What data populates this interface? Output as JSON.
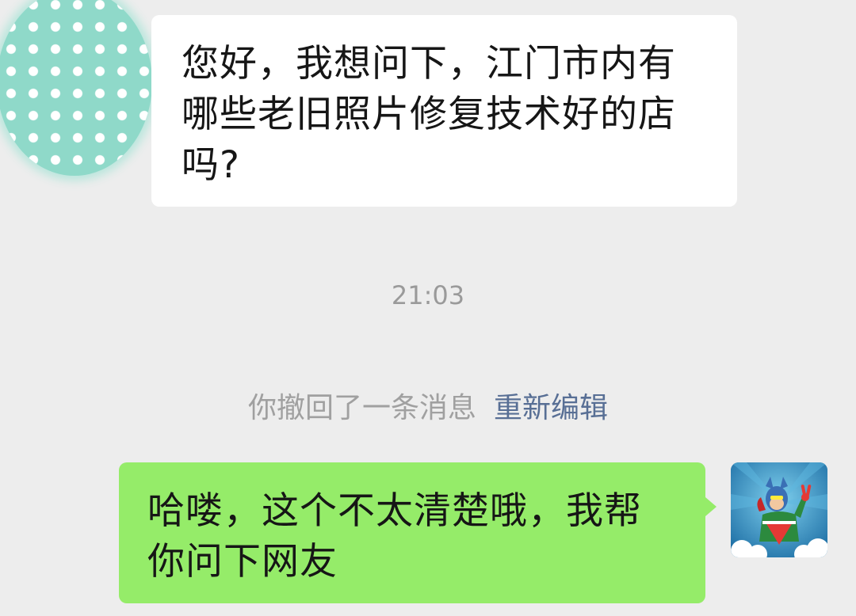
{
  "incoming_message": {
    "lines": [
      "您好，我想问下，江门市内有",
      "哪些老旧照片修复技术好的店",
      "吗?"
    ]
  },
  "timestamp": "21:03",
  "recall_notice": {
    "text": "你撤回了一条消息",
    "edit_label": "重新编辑"
  },
  "outgoing_message": {
    "lines": [
      "哈喽，这个不太清楚哦，我帮",
      "你问下网友"
    ]
  },
  "colors": {
    "background": "#ededed",
    "incoming_bubble": "#ffffff",
    "outgoing_bubble": "#95ec69",
    "link": "#586f95",
    "muted_text": "#a0a0a0"
  }
}
